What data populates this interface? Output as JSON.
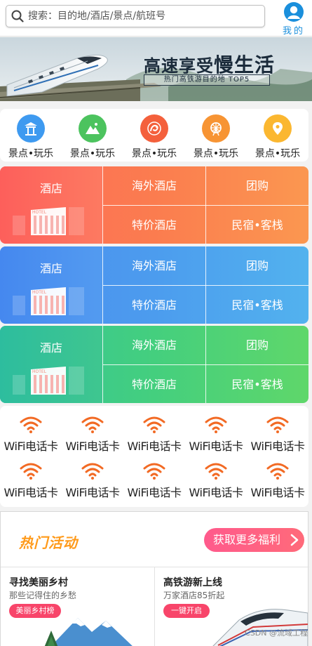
{
  "header": {
    "search_placeholder": "搜索：目的地/酒店/景点/航班号",
    "me_label": "我的"
  },
  "banner": {
    "title_prefix": "高速享受",
    "title_emphasis": "慢生活",
    "subtitle": "热门高铁游目的地 TOP5"
  },
  "categories": [
    {
      "label": "景点•玩乐",
      "icon": "pavilion-icon",
      "color": "#3e9af0"
    },
    {
      "label": "景点•玩乐",
      "icon": "mountain-icon",
      "color": "#4cc35e"
    },
    {
      "label": "景点•玩乐",
      "icon": "dragon-icon",
      "color": "#f4603c"
    },
    {
      "label": "景点•玩乐",
      "icon": "ferris-wheel-icon",
      "color": "#f79433"
    },
    {
      "label": "景点•玩乐",
      "icon": "location-pin-icon",
      "color": "#fbb730"
    }
  ],
  "grids": [
    {
      "left": "酒店",
      "cells": [
        "海外酒店",
        "团购",
        "特价酒店",
        "民宿•客栈"
      ],
      "hotel_sign": "HOTEL"
    },
    {
      "left": "酒店",
      "cells": [
        "海外酒店",
        "团购",
        "特价酒店",
        "民宿•客栈"
      ],
      "hotel_sign": "HOTEL"
    },
    {
      "left": "酒店",
      "cells": [
        "海外酒店",
        "团购",
        "特价酒店",
        "民宿•客栈"
      ],
      "hotel_sign": "HOTEL"
    }
  ],
  "wifi": {
    "items": [
      "WiFi电话卡",
      "WiFi电话卡",
      "WiFi电话卡",
      "WiFi电话卡",
      "WiFi电话卡",
      "WiFi电话卡",
      "WiFi电话卡",
      "WiFi电话卡",
      "WiFi电话卡",
      "WiFi电话卡"
    ],
    "icon": "wifi-icon",
    "color": "#f26a24"
  },
  "activity": {
    "title": "热门活动",
    "more_label": "获取更多福利",
    "cards": [
      {
        "title": "寻找美丽乡村",
        "subtitle": "那些记得住的乡愁",
        "button": "美丽乡村榜"
      },
      {
        "title": "高铁游新上线",
        "subtitle": "万家酒店85折起",
        "button": "一键开启"
      }
    ]
  },
  "watermark": "CSDN @流域工程"
}
